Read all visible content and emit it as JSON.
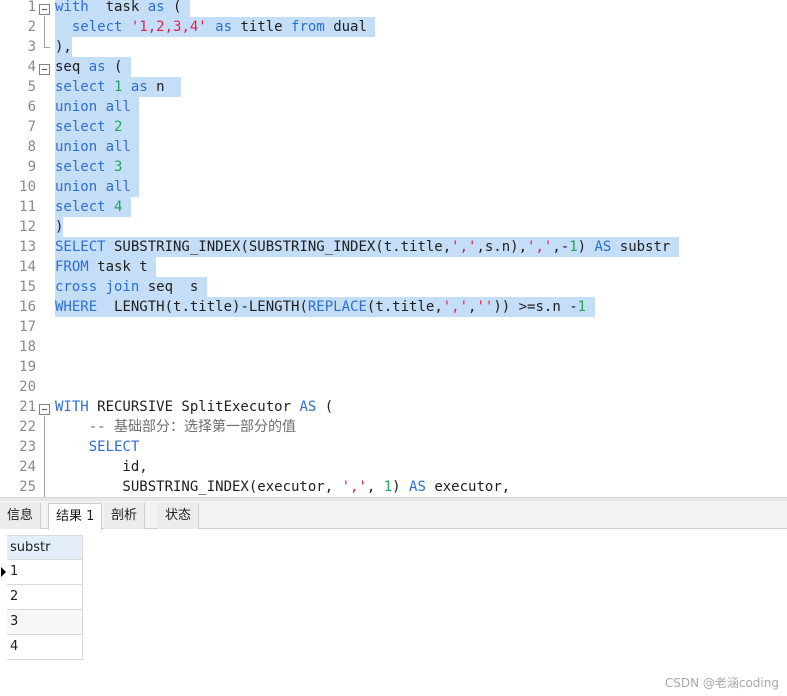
{
  "editor": {
    "line_numbers": [
      "1",
      "2",
      "3",
      "4",
      "5",
      "6",
      "7",
      "8",
      "9",
      "10",
      "11",
      "12",
      "13",
      "14",
      "15",
      "16",
      "17",
      "18",
      "19",
      "20",
      "21",
      "22",
      "23",
      "24",
      "25"
    ]
  },
  "tabs": [
    {
      "label": "信息"
    },
    {
      "label": "结果 1"
    },
    {
      "label": "剖析"
    },
    {
      "label": "状态"
    }
  ],
  "result": {
    "columns": [
      "substr"
    ],
    "rows": [
      "1",
      "2",
      "3",
      "4"
    ]
  },
  "watermark": "CSDN @老涵coding"
}
